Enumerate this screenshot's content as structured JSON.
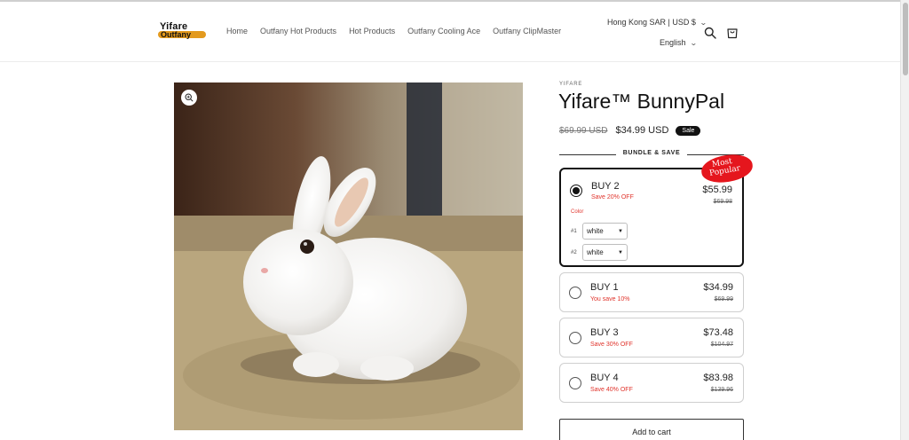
{
  "header": {
    "logo": {
      "line1": "Yifare",
      "line2": "Outfany"
    },
    "nav": [
      "Home",
      "Outfany Hot Products",
      "Hot Products",
      "Outfany Cooling Ace",
      "Outfany ClipMaster"
    ],
    "localization": "Hong Kong SAR | USD $",
    "language": "English",
    "icons": {
      "search": "search-icon",
      "cart": "cart-icon"
    }
  },
  "product": {
    "vendor": "YIFARE",
    "title": "Yifare™ BunnyPal",
    "compare_price": "$69.99 USD",
    "price": "$34.99 USD",
    "sale_badge": "Sale",
    "image_alt": "white bunny plush",
    "gallery_icon": "zoom-in-icon"
  },
  "bundle": {
    "heading": "BUNDLE & SAVE",
    "popular_badge": {
      "line1": "Most",
      "line2": "Popular"
    },
    "color_label": "Color",
    "variants": [
      {
        "num": "#1",
        "value": "white"
      },
      {
        "num": "#2",
        "value": "white"
      }
    ],
    "options": [
      {
        "label": "BUY 2",
        "save": "Save 20% OFF",
        "price": "$55.99",
        "compare": "$69.98",
        "selected": true
      },
      {
        "label": "BUY 1",
        "save": "You save 10%",
        "price": "$34.99",
        "compare": "$69.99",
        "selected": false
      },
      {
        "label": "BUY 3",
        "save": "Save 30% OFF",
        "price": "$73.48",
        "compare": "$104.97",
        "selected": false
      },
      {
        "label": "BUY 4",
        "save": "Save 40% OFF",
        "price": "$83.98",
        "compare": "$139.96",
        "selected": false
      }
    ]
  },
  "add_to_cart": "Add to cart",
  "colors": {
    "sale_red": "#e0342c",
    "badge_red": "#e5161d",
    "ink": "#121212",
    "logo_orange": "#e39a1e"
  }
}
